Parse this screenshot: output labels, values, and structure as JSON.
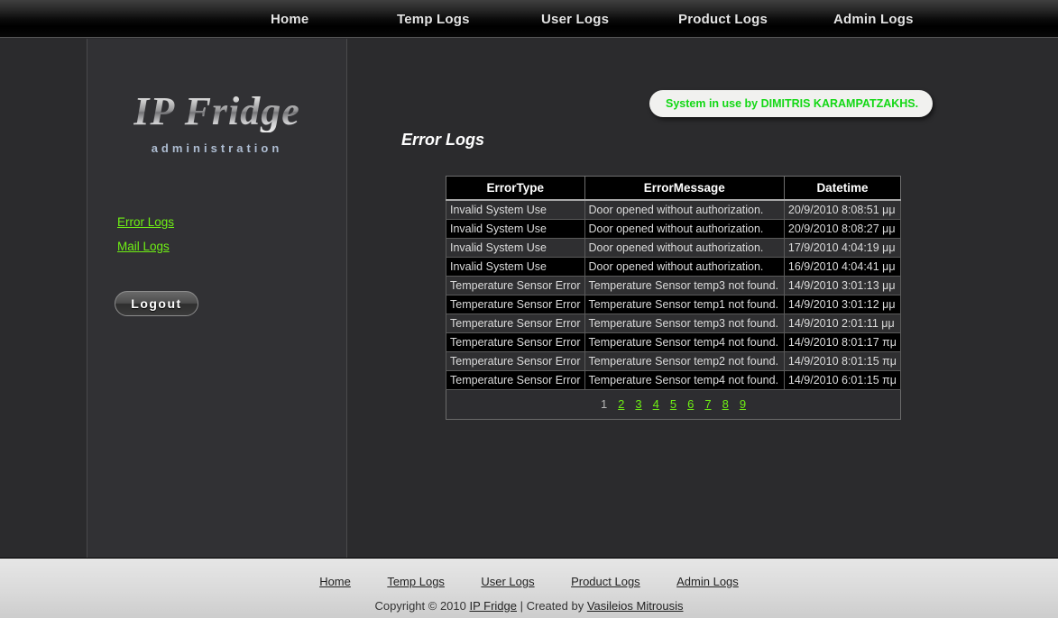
{
  "topnav": {
    "items": [
      {
        "label": "Home"
      },
      {
        "label": "Temp Logs"
      },
      {
        "label": "User Logs"
      },
      {
        "label": "Product Logs"
      },
      {
        "label": "Admin Logs"
      }
    ]
  },
  "sidebar": {
    "logo": "IP Fridge",
    "logo_sub": "administration",
    "links": [
      {
        "label": "Error Logs"
      },
      {
        "label": "Mail Logs"
      }
    ],
    "logout_label": "Logout"
  },
  "main": {
    "notification": "System in use by DIMITRIS KARAMPATZAKHS.",
    "page_title": "Error Logs",
    "table": {
      "headers": [
        "ErrorType",
        "ErrorMessage",
        "Datetime"
      ],
      "rows": [
        [
          "Invalid System Use",
          "Door opened without authorization.",
          "20/9/2010 8:08:51 μμ"
        ],
        [
          "Invalid System Use",
          "Door opened without authorization.",
          "20/9/2010 8:08:27 μμ"
        ],
        [
          "Invalid System Use",
          "Door opened without authorization.",
          "17/9/2010 4:04:19 μμ"
        ],
        [
          "Invalid System Use",
          "Door opened without authorization.",
          "16/9/2010 4:04:41 μμ"
        ],
        [
          "Temperature Sensor Error",
          "Temperature Sensor temp3 not found.",
          "14/9/2010 3:01:13 μμ"
        ],
        [
          "Temperature Sensor Error",
          "Temperature Sensor temp1 not found.",
          "14/9/2010 3:01:12 μμ"
        ],
        [
          "Temperature Sensor Error",
          "Temperature Sensor temp3 not found.",
          "14/9/2010 2:01:11 μμ"
        ],
        [
          "Temperature Sensor Error",
          "Temperature Sensor temp4 not found.",
          "14/9/2010 8:01:17 πμ"
        ],
        [
          "Temperature Sensor Error",
          "Temperature Sensor temp2 not found.",
          "14/9/2010 8:01:15 πμ"
        ],
        [
          "Temperature Sensor Error",
          "Temperature Sensor temp4 not found.",
          "14/9/2010 6:01:15 πμ"
        ]
      ]
    },
    "pagination": {
      "pages": [
        "1",
        "2",
        "3",
        "4",
        "5",
        "6",
        "7",
        "8",
        "9"
      ],
      "current": "1"
    }
  },
  "footer": {
    "nav": [
      {
        "label": "Home"
      },
      {
        "label": "Temp Logs"
      },
      {
        "label": "User Logs"
      },
      {
        "label": "Product Logs"
      },
      {
        "label": "Admin Logs"
      }
    ],
    "copyright_prefix": "Copyright © 2010 ",
    "site_link": "IP Fridge",
    "copyright_mid": " | Created by ",
    "author_link": "Vasileios Mitrousis"
  },
  "colors": {
    "link_green": "#6ff014",
    "notify_green": "#12d814",
    "page_bg": "#2b2b2d"
  }
}
